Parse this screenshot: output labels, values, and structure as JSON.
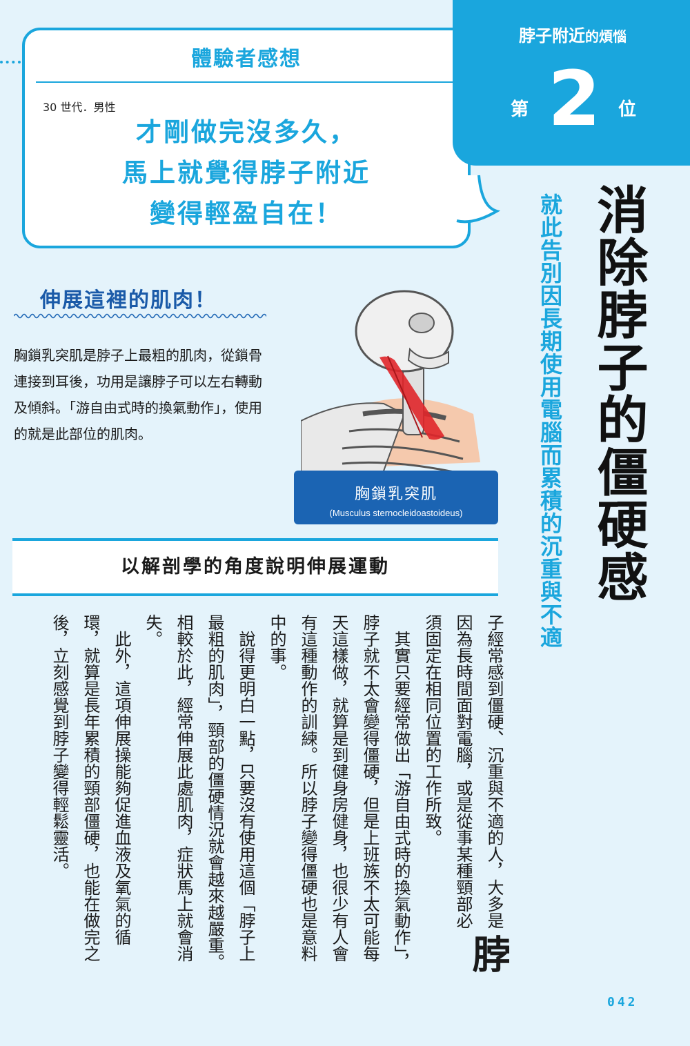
{
  "bubble": {
    "title": "體驗者感想",
    "reviewer": "30 世代．男性",
    "quote_lines": [
      "才剛做完沒多久，",
      "馬上就覺得脖子附近",
      "變得輕盈自在！"
    ]
  },
  "tab": {
    "category_bold": "脖子附近",
    "category_rest": "的煩惱",
    "rank_prefix": "第",
    "rank_number": "2",
    "rank_suffix": "位"
  },
  "title": "消除脖子的僵硬感",
  "subtitle": "就此告別因長期使用電腦而累積的沉重與不適",
  "stretch": {
    "heading": "伸展這裡的肌肉！",
    "body": "胸鎖乳突肌是脖子上最粗的肌肉，從鎖骨連接到耳後，功用是讓脖子可以左右轉動及傾斜。「游自由式時的換氣動作」，使用的就是此部位的肌肉。"
  },
  "figure": {
    "label_main": "胸鎖乳突肌",
    "label_sub": "(Musculus sternocleidoastoideus)"
  },
  "section_banner": "以解剖學的角度說明伸展運動",
  "article": {
    "drop_char": "脖",
    "p1": "子經常感到僵硬、沉重與不適的人，大多是因為長時間面對電腦，或是從事某種頸部必須固定在相同位置的工作所致。",
    "p2": "其實只要經常做出「游自由式時的換氣動作」，脖子就不太會變得僵硬，但是上班族不太可能每天這樣做，就算是到健身房健身，也很少有人會有這種動作的訓練。所以脖子變得僵硬也是意料中的事。",
    "p3": "說得更明白一點，只要沒有使用這個「脖子上最粗的肌肉」，頸部的僵硬情況就會越來越嚴重。相較於此，經常伸展此處肌肉，症狀馬上就會消失。",
    "p4": "此外，這項伸展操能夠促進血液及氧氣的循環，就算是長年累積的頸部僵硬，也能在做完之後，立刻感覺到脖子變得輕鬆靈活。"
  },
  "page_number": "042",
  "colors": {
    "accent": "#1aa6dd",
    "label_bg": "#1b64b3",
    "page_bg": "#e4f3fb",
    "muscle": "#e0262a"
  }
}
